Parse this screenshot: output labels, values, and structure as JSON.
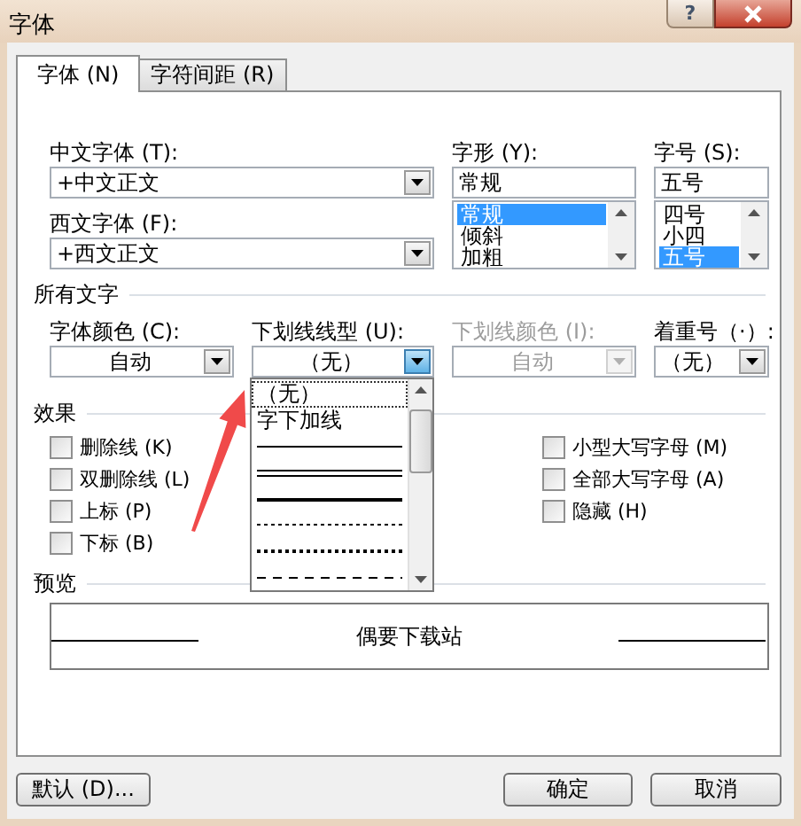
{
  "window": {
    "title": "字体",
    "help": "?"
  },
  "tabs": [
    {
      "label": "字体 (N)",
      "selected": true
    },
    {
      "label": "字符间距 (R)",
      "selected": false
    }
  ],
  "font": {
    "chinese_label": "中文字体 (T):",
    "chinese_value": "+中文正文",
    "western_label": "西文字体 (F):",
    "western_value": "+西文正文"
  },
  "style": {
    "label": "字形 (Y):",
    "value": "常规",
    "options": [
      {
        "label": "常规",
        "selected": true
      },
      {
        "label": "倾斜",
        "selected": false
      },
      {
        "label": "加粗",
        "selected": false
      }
    ]
  },
  "size": {
    "label": "字号 (S):",
    "value": "五号",
    "options": [
      {
        "label": "四号",
        "selected": false
      },
      {
        "label": "小四",
        "selected": false
      },
      {
        "label": "五号",
        "selected": true
      }
    ]
  },
  "all_text": {
    "heading": "所有文字",
    "fields": [
      {
        "label": "字体颜色 (C):",
        "value": "自动",
        "disabled": false,
        "open": false
      },
      {
        "label": "下划线线型 (U):",
        "value": "（无）",
        "disabled": false,
        "open": true
      },
      {
        "label": "下划线颜色 (I):",
        "value": "自动",
        "disabled": true,
        "open": false
      },
      {
        "label": "着重号（·）:",
        "value": "（无）",
        "disabled": false,
        "open": false
      }
    ]
  },
  "underline_menu": {
    "items": [
      {
        "kind": "text",
        "label": "（无）",
        "selected": true
      },
      {
        "kind": "text",
        "label": "字下加线",
        "selected": false
      },
      {
        "kind": "solid",
        "selected": false
      },
      {
        "kind": "double",
        "selected": false
      },
      {
        "kind": "thick",
        "selected": false
      },
      {
        "kind": "dashed",
        "selected": false
      },
      {
        "kind": "dotted",
        "selected": false
      },
      {
        "kind": "long-dash",
        "selected": false
      }
    ]
  },
  "effects": {
    "heading": "效果",
    "left": [
      {
        "label": "删除线 (K)",
        "checked": false
      },
      {
        "label": "双删除线 (L)",
        "checked": false
      },
      {
        "label": "上标 (P)",
        "checked": false
      },
      {
        "label": "下标 (B)",
        "checked": false
      }
    ],
    "right": [
      {
        "label": "小型大写字母 (M)",
        "checked": false
      },
      {
        "label": "全部大写字母 (A)",
        "checked": false
      },
      {
        "label": "隐藏 (H)",
        "checked": false
      }
    ]
  },
  "preview": {
    "heading": "预览",
    "text": "偶要下载站"
  },
  "buttons": [
    "默认 (D)...",
    "确定",
    "取消"
  ]
}
